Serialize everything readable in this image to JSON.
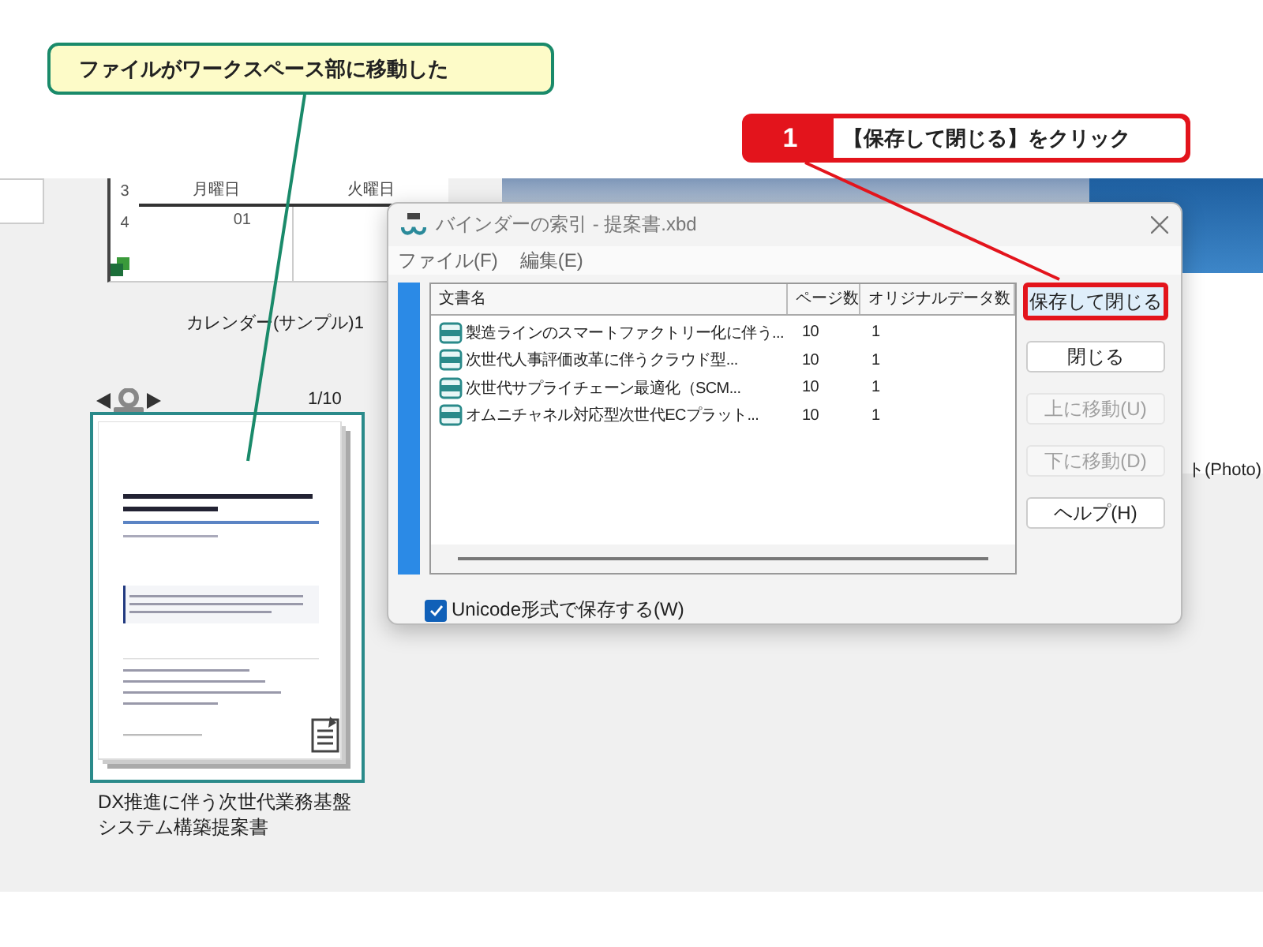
{
  "callout_note": {
    "text": "ファイルがワークスペース部に移動した"
  },
  "callout_step": {
    "number": "1",
    "text": "【保存して閉じる】をクリック"
  },
  "workspace": {
    "calendar": {
      "row_numbers": [
        "3",
        "4"
      ],
      "days": [
        "月曜日",
        "火曜日"
      ],
      "date": "01",
      "label": "カレンダー(サンプル)1"
    },
    "photo_label": "ト(Photo)",
    "document": {
      "page_counter": "1/10",
      "label": "DX推進に伴う次世代業務基盤システム構築提案書"
    }
  },
  "dialog": {
    "title": "バインダーの索引 - 提案書.xbd",
    "menu": [
      "ファイル(F)",
      "編集(E)"
    ],
    "columns": [
      "文書名",
      "ページ数",
      "オリジナルデータ数"
    ],
    "rows": [
      {
        "name": "製造ラインのスマートファクトリー化に伴う...",
        "pages": "10",
        "originals": "1"
      },
      {
        "name": "次世代人事評価改革に伴うクラウド型...",
        "pages": "10",
        "originals": "1"
      },
      {
        "name": "次世代サプライチェーン最適化（SCM...",
        "pages": "10",
        "originals": "1"
      },
      {
        "name": "オムニチャネル対応型次世代ECプラット...",
        "pages": "10",
        "originals": "1"
      }
    ],
    "buttons": [
      {
        "label": "保存して閉じる",
        "disabled": false,
        "marked": true
      },
      {
        "label": "閉じる",
        "disabled": false,
        "marked": false
      },
      {
        "label": "上に移動(U)",
        "disabled": true,
        "marked": false
      },
      {
        "label": "下に移動(D)",
        "disabled": true,
        "marked": false
      },
      {
        "label": "ヘルプ(H)",
        "disabled": false,
        "marked": false
      }
    ],
    "unicode_option": {
      "label": "Unicode形式で保存する(W)",
      "checked": true
    }
  }
}
